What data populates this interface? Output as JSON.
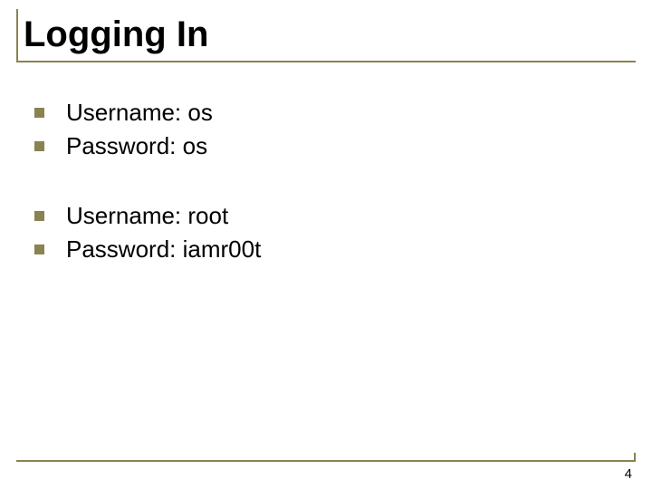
{
  "title": "Logging In",
  "groups": [
    {
      "items": [
        "Username: os",
        "Password: os"
      ]
    },
    {
      "items": [
        "Username: root",
        "Password: iamr00t"
      ]
    }
  ],
  "page_number": "4"
}
